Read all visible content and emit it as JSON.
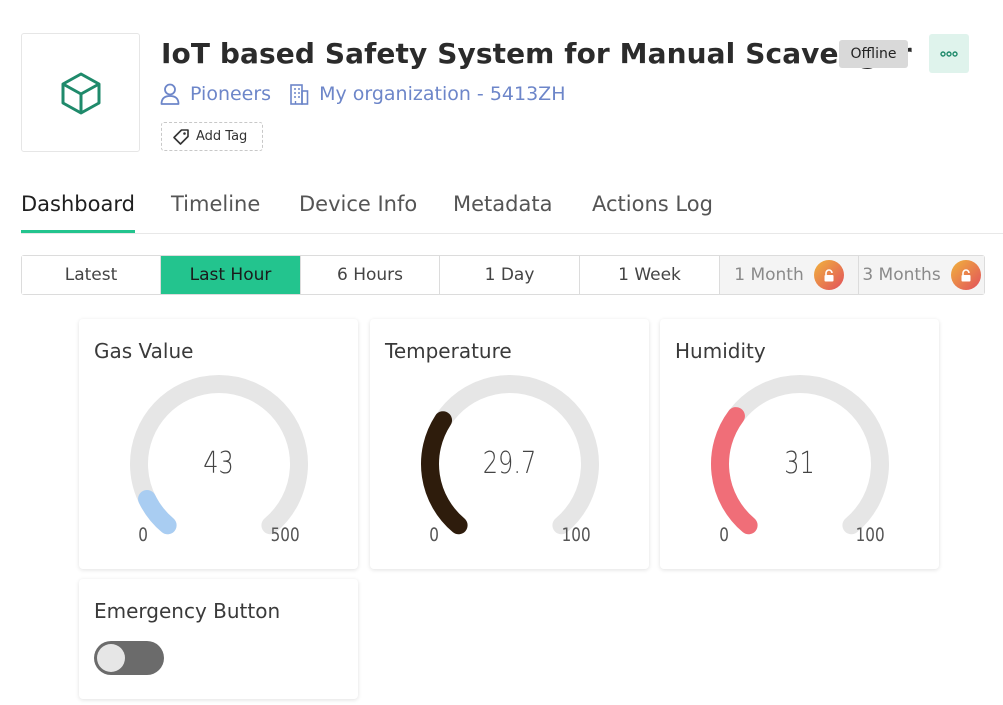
{
  "device": {
    "title": "IoT based Safety System for Manual Scavenger",
    "status": "Offline",
    "owner": "Pioneers",
    "organization": "My organization - 5413ZH",
    "add_tag_label": "Add Tag",
    "icon": "cube-icon"
  },
  "tabs": [
    {
      "label": "Dashboard",
      "active": true
    },
    {
      "label": "Timeline"
    },
    {
      "label": "Device Info"
    },
    {
      "label": "Metadata"
    },
    {
      "label": "Actions Log"
    }
  ],
  "periods": [
    {
      "label": "Latest"
    },
    {
      "label": "Last Hour",
      "active": true
    },
    {
      "label": "6 Hours"
    },
    {
      "label": "1 Day"
    },
    {
      "label": "1 Week"
    },
    {
      "label": "1 Month",
      "locked": true
    },
    {
      "label": "3 Months",
      "locked": true
    }
  ],
  "widgets": {
    "gas": {
      "title": "Gas Value",
      "value": "43",
      "min": "0",
      "max": "500",
      "fraction": 0.086,
      "color": "#a9cdf2"
    },
    "temperature": {
      "title": "Temperature",
      "value": "29.7",
      "min": "0",
      "max": "100",
      "fraction": 0.297,
      "color": "#2e1c0c"
    },
    "humidity": {
      "title": "Humidity",
      "value": "31",
      "min": "0",
      "max": "100",
      "fraction": 0.31,
      "color": "#f06e78"
    },
    "emergency": {
      "title": "Emergency Button",
      "state": "off"
    }
  },
  "colors": {
    "accent": "#23c48e",
    "link": "#6d86c9",
    "track": "#e6e6e6"
  }
}
